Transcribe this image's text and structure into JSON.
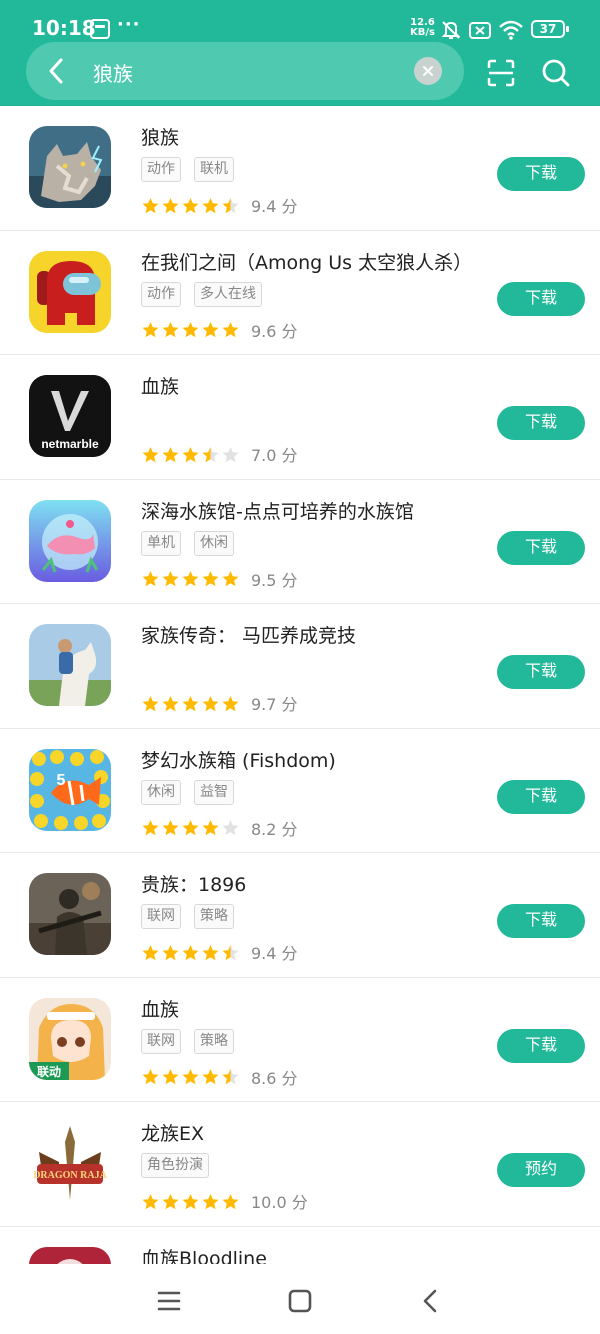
{
  "status_bar": {
    "time": "10:18",
    "dots": "···",
    "speed_top": "12.6",
    "speed_bottom": "KB/s",
    "battery": "37"
  },
  "search": {
    "query": "狼族"
  },
  "colors": {
    "accent": "#22b89a",
    "star": "#ffba00",
    "star_empty": "#e2e2e2"
  },
  "icons": {
    "back": "chevron-left-icon",
    "clear": "close-icon",
    "scan": "scan-icon",
    "search": "search-icon"
  },
  "apps": [
    {
      "name": "狼族",
      "tags": [
        "动作",
        "联机"
      ],
      "stars": 4.5,
      "score": "9.4 分",
      "button": "下载"
    },
    {
      "name": "在我们之间（Among Us 太空狼人杀）",
      "tags": [
        "动作",
        "多人在线"
      ],
      "stars": 5,
      "score": "9.6 分",
      "button": "下载"
    },
    {
      "name": "血族",
      "tags": [],
      "stars": 3.5,
      "score": "7.0 分",
      "button": "下载",
      "icon_text": "netmarble"
    },
    {
      "name": "深海水族馆-点点可培养的水族馆",
      "tags": [
        "单机",
        "休闲"
      ],
      "stars": 5,
      "score": "9.5 分",
      "button": "下载"
    },
    {
      "name": "家族传奇： 马匹养成竞技",
      "tags": [],
      "stars": 5,
      "score": "9.7 分",
      "button": "下载"
    },
    {
      "name": "梦幻水族箱 (Fishdom)",
      "tags": [
        "休闲",
        "益智"
      ],
      "stars": 4,
      "score": "8.2 分",
      "button": "下载",
      "icon_text": "5"
    },
    {
      "name": "贵族：1896",
      "tags": [
        "联网",
        "策略"
      ],
      "stars": 4.5,
      "score": "9.4 分",
      "button": "下载"
    },
    {
      "name": "血族",
      "tags": [
        "联网",
        "策略"
      ],
      "stars": 4.5,
      "score": "8.6 分",
      "button": "下载",
      "icon_text": "联动"
    },
    {
      "name": "龙族EX",
      "tags": [
        "角色扮演"
      ],
      "stars": 5,
      "score": "10.0 分",
      "button": "预约",
      "icon_text": "DRAGON RAJA"
    },
    {
      "name": "血族Bloodline",
      "tags": [],
      "stars": 0,
      "score": "",
      "button": ""
    }
  ],
  "navbar": {
    "menu": "menu-icon",
    "home": "home-icon",
    "back": "back-icon"
  }
}
